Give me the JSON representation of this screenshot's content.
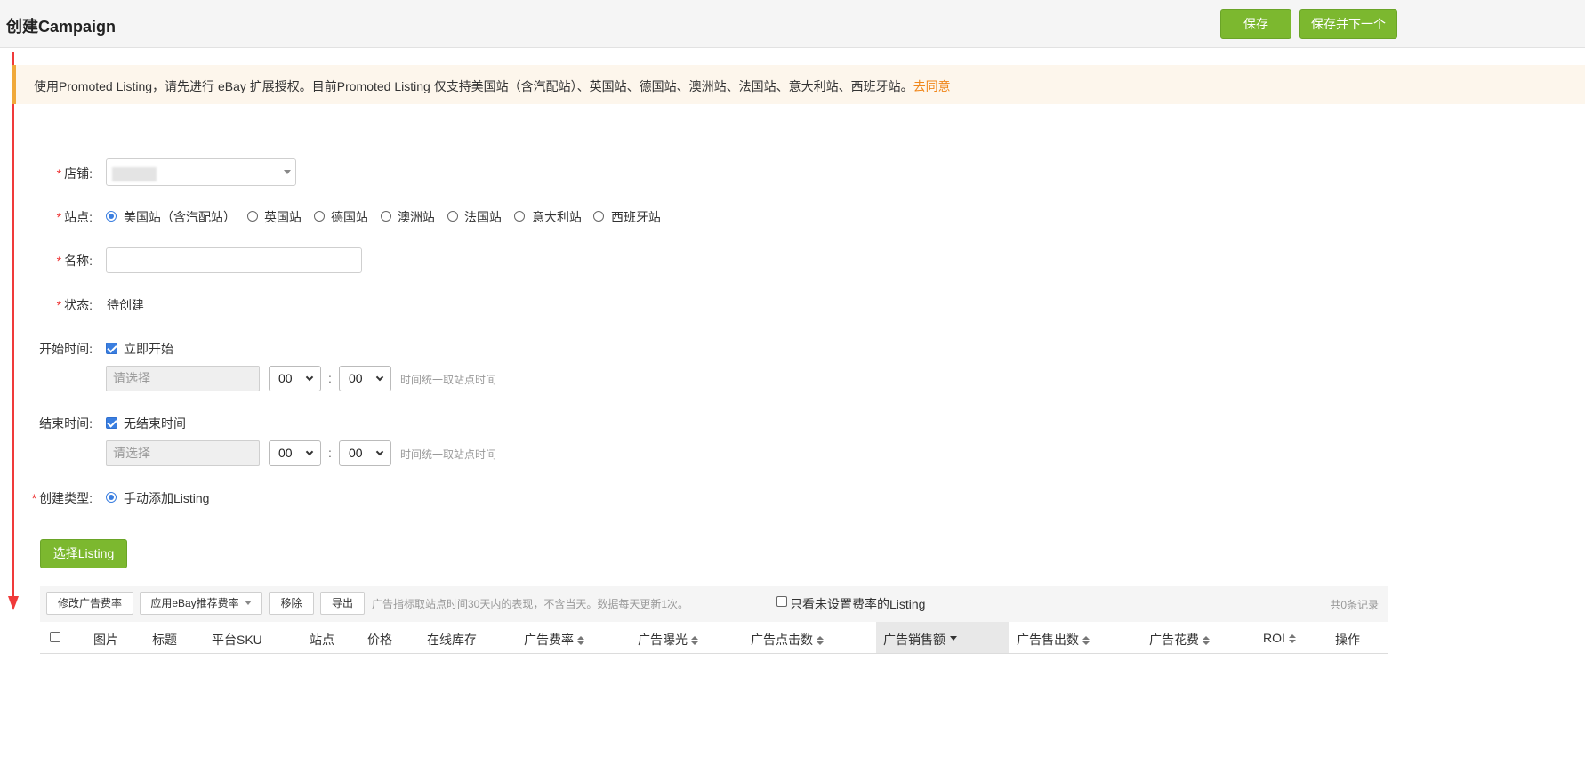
{
  "header": {
    "title": "创建Campaign",
    "save_label": "保存",
    "save_next_label": "保存并下一个"
  },
  "notice": {
    "text": "使用Promoted Listing，请先进行 eBay 扩展授权。目前Promoted Listing 仅支持美国站（含汽配站）、英国站、德国站、澳洲站、法国站、意大利站、西班牙站。",
    "link": "去同意"
  },
  "form": {
    "shop_label": "店铺:",
    "site_label": "站点:",
    "sites": [
      "美国站（含汽配站）",
      "英国站",
      "德国站",
      "澳洲站",
      "法国站",
      "意大利站",
      "西班牙站"
    ],
    "selected_site": "美国站（含汽配站）",
    "name_label": "名称:",
    "name_value": "",
    "status_label": "状态:",
    "status_value": "待创建",
    "start_label": "开始时间:",
    "start_now_label": "立即开始",
    "start_now_checked": true,
    "date_placeholder": "请选择",
    "hour_value": "00",
    "minute_value": "00",
    "time_colon": ":",
    "time_hint": "时间统一取站点时间",
    "end_label": "结束时间:",
    "no_end_label": "无结束时间",
    "no_end_checked": true,
    "create_type_label": "创建类型:",
    "create_type_option": "手动添加Listing"
  },
  "listing": {
    "select_button": "选择Listing",
    "toolbar": {
      "edit_rate": "修改广告费率",
      "apply_ebay_rate": "应用eBay推荐费率",
      "remove": "移除",
      "export": "导出",
      "note": "广告指标取站点时间30天内的表现，不含当天。数据每天更新1次。",
      "only_unset_label": "只看未设置费率的Listing",
      "only_unset_checked": false,
      "record_count": "共0条记录"
    },
    "columns": [
      "图片",
      "标题",
      "平台SKU",
      "站点",
      "价格",
      "在线库存",
      "广告费率",
      "广告曝光",
      "广告点击数",
      "广告销售额",
      "广告售出数",
      "广告花费",
      "ROI",
      "操作"
    ],
    "sorted_column": "广告销售额",
    "rows": []
  },
  "colors": {
    "primary_green": "#7cb82f",
    "accent_blue": "#3a7ee0",
    "link_orange": "#f0861a",
    "annotation_red": "#f03a3a"
  }
}
